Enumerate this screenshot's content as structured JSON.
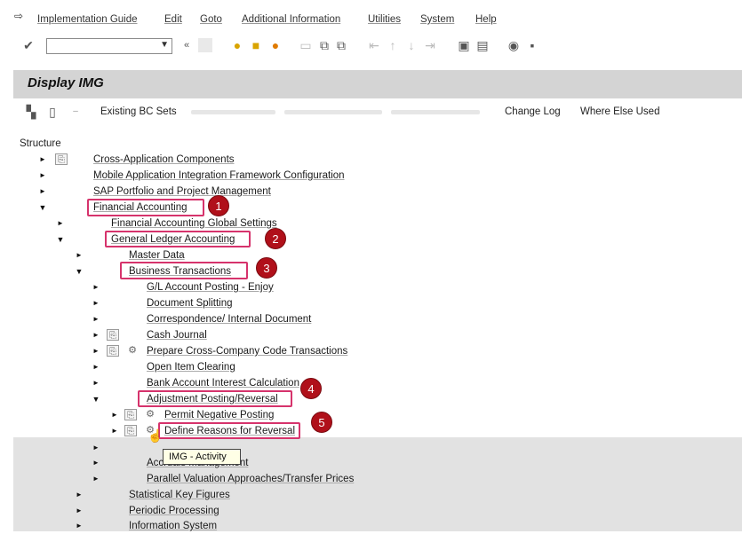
{
  "menu": [
    "Implementation Guide",
    "Edit",
    "Goto",
    "Additional Information",
    "Utilities",
    "System",
    "Help"
  ],
  "toolbar": {
    "command_value": ""
  },
  "title": "Display IMG",
  "app_toolbar": {
    "existing_bc_sets": "Existing BC Sets",
    "change_log": "Change Log",
    "where_else_used": "Where Else Used"
  },
  "tree": {
    "header": "Structure",
    "nodes": [
      "Cross-Application Components",
      "Mobile Application Integration Framework Configuration",
      "SAP Portfolio and Project Management",
      "Financial Accounting",
      "Financial Accounting Global Settings",
      "General Ledger Accounting",
      "Master Data",
      "Business Transactions",
      "G/L Account Posting - Enjoy",
      "Document Splitting",
      "Correspondence/ Internal Document",
      "Cash Journal",
      "Prepare Cross-Company Code Transactions",
      "Open Item Clearing",
      "Bank Account Interest Calculation",
      "Adjustment Posting/Reversal",
      "Permit Negative Posting",
      "Define Reasons for Reversal",
      "Accruals Management",
      "Parallel Valuation Approaches/Transfer Prices",
      "Statistical Key Figures",
      "Periodic Processing",
      "Information System"
    ]
  },
  "tooltip": "IMG - Activity",
  "badges": [
    "1",
    "2",
    "3",
    "4",
    "5"
  ],
  "colors": {
    "highlight": "#d6336c",
    "badge": "#b0101a",
    "title_bar": "#d4d4d4"
  }
}
